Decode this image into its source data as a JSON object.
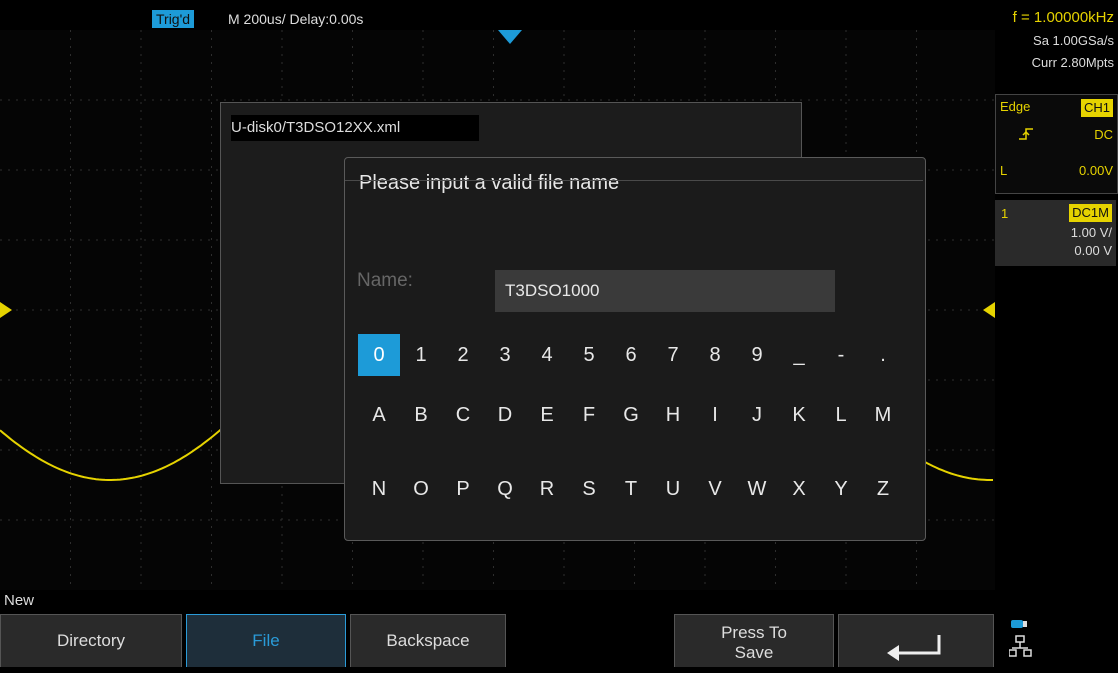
{
  "status": {
    "trig_state": "Trig'd",
    "timebase": "M 200us/  Delay:0.00s",
    "frequency": "f = 1.00000kHz"
  },
  "right_panel": {
    "sample_rate": "Sa 1.00GSa/s",
    "memory_depth": "Curr 2.80Mpts",
    "trigger": {
      "type": "Edge",
      "source": "CH1",
      "slope_icon": "rising-edge-icon",
      "coupling": "DC",
      "level_label": "L",
      "level": "0.00V"
    },
    "channel": {
      "number": "1",
      "coupling": "DC1M",
      "scale": "1.00 V/",
      "offset": "0.00 V"
    }
  },
  "file_dialog": {
    "path": "U-disk0/T3DSO12XX.xml"
  },
  "name_dialog": {
    "title": "Please input a valid file name",
    "name_label": "Name:",
    "name_value": "T3DSO1000",
    "keys_row1": [
      "0",
      "1",
      "2",
      "3",
      "4",
      "5",
      "6",
      "7",
      "8",
      "9",
      "_",
      "-",
      "."
    ],
    "keys_row2": [
      "A",
      "B",
      "C",
      "D",
      "E",
      "F",
      "G",
      "H",
      "I",
      "J",
      "K",
      "L",
      "M"
    ],
    "keys_row3": [
      "N",
      "O",
      "P",
      "Q",
      "R",
      "S",
      "T",
      "U",
      "V",
      "W",
      "X",
      "Y",
      "Z"
    ],
    "selected_key": "0"
  },
  "menu": {
    "title": "New",
    "directory": "Directory",
    "file": "File",
    "backspace": "Backspace",
    "press_to_line1": "Press To",
    "press_to_line2": "Save",
    "back_icon": "return-arrow-icon"
  },
  "colors": {
    "accent": "#1d9bd8",
    "channel1": "#e6d300",
    "grid": "#3a3a3a"
  }
}
